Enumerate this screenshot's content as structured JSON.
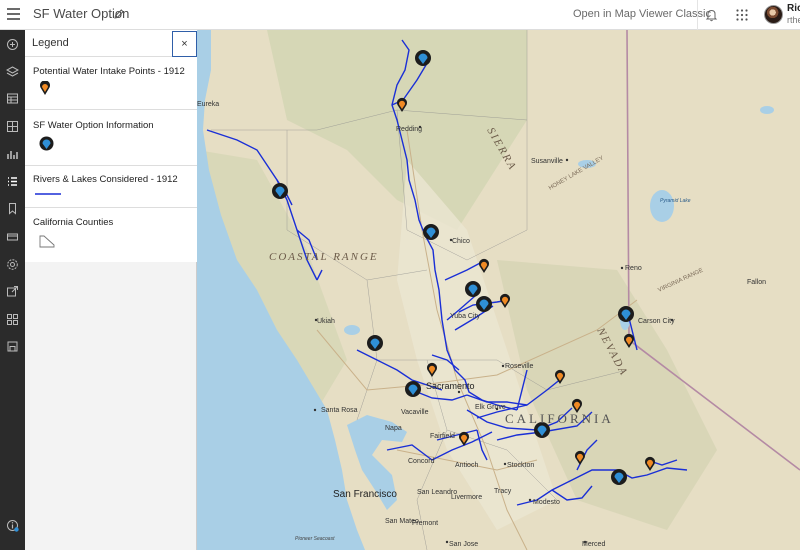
{
  "header": {
    "title": "SF Water Option",
    "open_classic_label": "Open in Map Viewer Classic",
    "user_name": "Ric",
    "user_id": "rthe"
  },
  "sidebar": {
    "items": [
      "add-icon",
      "layers-icon",
      "table-icon",
      "basemap-icon",
      "chart-icon",
      "legend-icon",
      "bookmark-icon",
      "print-icon",
      "settings-icon",
      "share-icon",
      "apps-icon",
      "save-icon",
      "info-icon"
    ]
  },
  "legend": {
    "title": "Legend",
    "close_label": "×",
    "sections": [
      {
        "title": "Potential Water Intake Points - 1912",
        "symbol": "orange-pin"
      },
      {
        "title": "SF Water Option Information",
        "symbol": "blue-pin"
      },
      {
        "title": "Rivers & Lakes Considered - 1912",
        "symbol": "blue-line"
      },
      {
        "title": "California Counties",
        "symbol": "polygon-outline"
      }
    ]
  },
  "map": {
    "regions": [
      "COASTAL RANGE",
      "CALIFORNIA",
      "NEVADA",
      "SIERRA"
    ],
    "places": [
      "Eureka",
      "Redding",
      "Susanville",
      "Chico",
      "Reno",
      "Fallon",
      "Carson City",
      "Ukiah",
      "Yuba City",
      "Roseville",
      "Sacramento",
      "Santa Rosa",
      "Vacaville",
      "Elk Grove",
      "Napa",
      "Fairfield",
      "Concord",
      "Antioch",
      "Stockton",
      "San Francisco",
      "San Leandro",
      "Livermore",
      "Tracy",
      "Modesto",
      "San Mateo",
      "Fremont",
      "San Jose",
      "Merced",
      "Pyramid Lake",
      "HONEY LAKE VALLEY",
      "VIRGINIA RANGE"
    ],
    "credit": "Pioneer Seacoast",
    "colors": {
      "river": "#1a2fd6",
      "intake_pin": "#f08a24",
      "info_pin": "#2f8fd6",
      "land": "#e8e0c8",
      "water": "#a9cfe6"
    }
  }
}
